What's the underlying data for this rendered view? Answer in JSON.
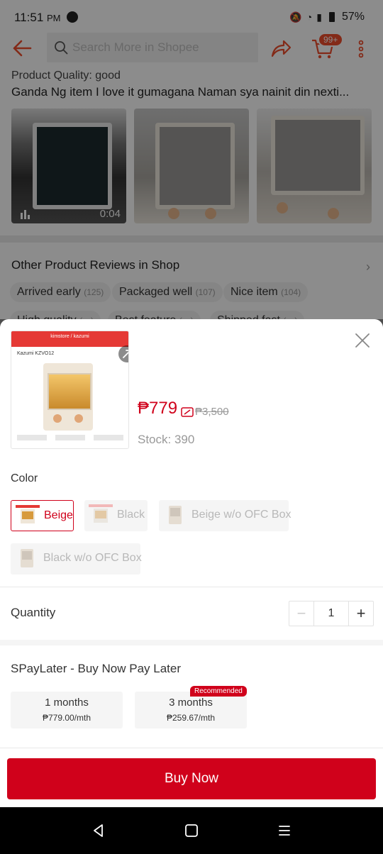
{
  "status_bar": {
    "time": "11:51",
    "time_suffix": "PM",
    "battery": "57%"
  },
  "header": {
    "search_placeholder": "Search More in Shopee",
    "cart_badge": "99+"
  },
  "background": {
    "product_quality": "Product Quality: good",
    "review_text": "Ganda Ng item I love it gumagana Naman sya nainit din nexti...",
    "video_duration": "0:04",
    "other_reviews_title": "Other Product Reviews in Shop",
    "chips": [
      {
        "label": "Arrived early",
        "count": "(125)"
      },
      {
        "label": "Packaged well",
        "count": "(107)"
      },
      {
        "label": "Nice item",
        "count": "(104)"
      },
      {
        "label": "High quality",
        "count": "(---)"
      },
      {
        "label": "Best feature",
        "count": "(---)"
      },
      {
        "label": "Shipped fast",
        "count": "(---)"
      }
    ]
  },
  "sheet": {
    "image": {
      "brand": "kimstore / kazumi",
      "name": "Kazumi KZVO12"
    },
    "price": "₱779",
    "original_price": "₱3,500",
    "stock": "Stock: 390",
    "color_label": "Color",
    "colors": [
      {
        "label": "Beige",
        "selected": true
      },
      {
        "label": "Black",
        "selected": false
      },
      {
        "label": "Beige w/o OFC Box",
        "selected": false
      },
      {
        "label": "Black w/o OFC Box",
        "selected": false
      }
    ],
    "quantity_label": "Quantity",
    "quantity_minus": "−",
    "quantity": "1",
    "quantity_plus": "+",
    "spaylater_title": "SPayLater - Buy Now Pay Later",
    "plans": [
      {
        "months": "1 months",
        "price": "₱779.00/mth"
      },
      {
        "months": "3 months",
        "price": "₱259.67/mth"
      }
    ],
    "recommended": "Recommended",
    "buy_now": "Buy Now"
  },
  "colors": {
    "accent": "#d0011b",
    "shopee_orange": "#ee4d2d"
  }
}
